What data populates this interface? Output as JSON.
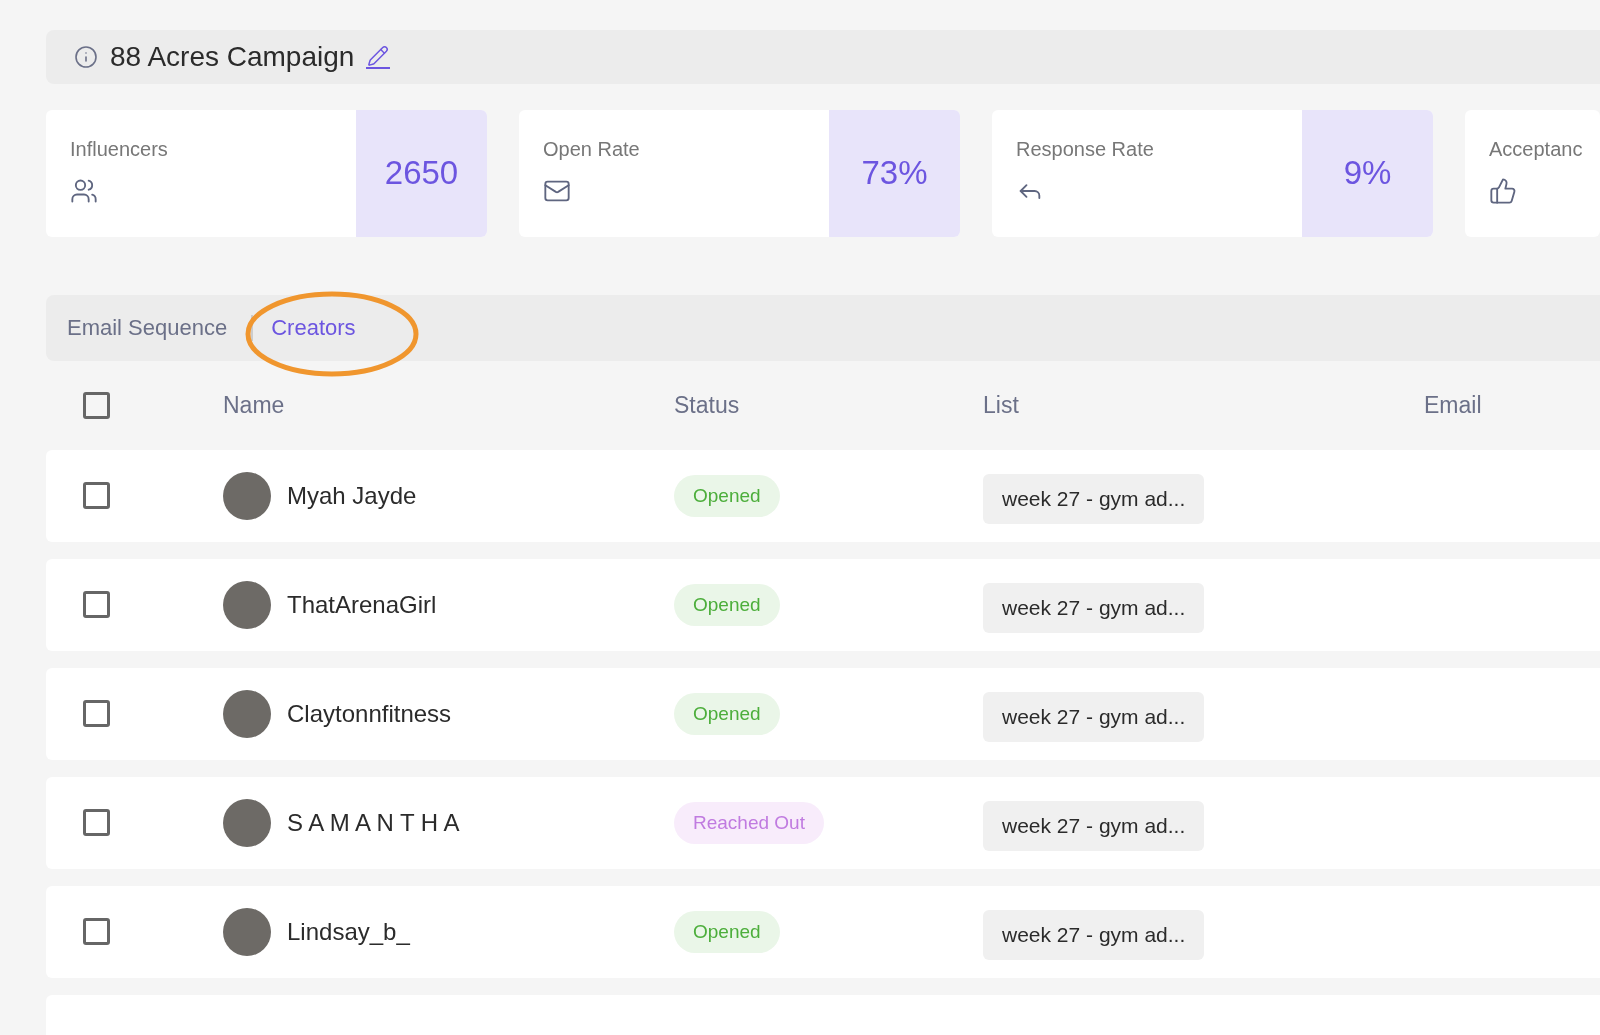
{
  "campaign": {
    "title": "88 Acres Campaign"
  },
  "stats": [
    {
      "label": "Influencers",
      "value": "2650"
    },
    {
      "label": "Open Rate",
      "value": "73%"
    },
    {
      "label": "Response Rate",
      "value": "9%"
    },
    {
      "label": "Acceptanc"
    }
  ],
  "tabs": [
    {
      "label": "Email Sequence",
      "selected": false
    },
    {
      "label": "Creators",
      "selected": true,
      "circled": true
    }
  ],
  "table": {
    "select_all": {
      "checked": false
    },
    "columns": [
      "Name",
      "Status",
      "List",
      "Email"
    ],
    "rows": [
      {
        "checked": false,
        "name": "Myah Jayde",
        "status": "Opened",
        "kind": "opened",
        "list": "week 27 - gym ad..."
      },
      {
        "checked": false,
        "name": "ThatArenaGirl",
        "status": "Opened",
        "kind": "opened",
        "list": "week 27 - gym ad..."
      },
      {
        "checked": false,
        "name": "Claytonnfitness",
        "status": "Opened",
        "kind": "opened",
        "list": "week 27 - gym ad..."
      },
      {
        "checked": false,
        "name": "S A M A N T H A",
        "status": "Reached Out",
        "kind": "reached_out",
        "list": "week 27 - gym ad..."
      },
      {
        "checked": false,
        "name": "Lindsay_b_",
        "status": "Opened",
        "kind": "opened",
        "list": "week 27 - gym ad..."
      }
    ]
  }
}
